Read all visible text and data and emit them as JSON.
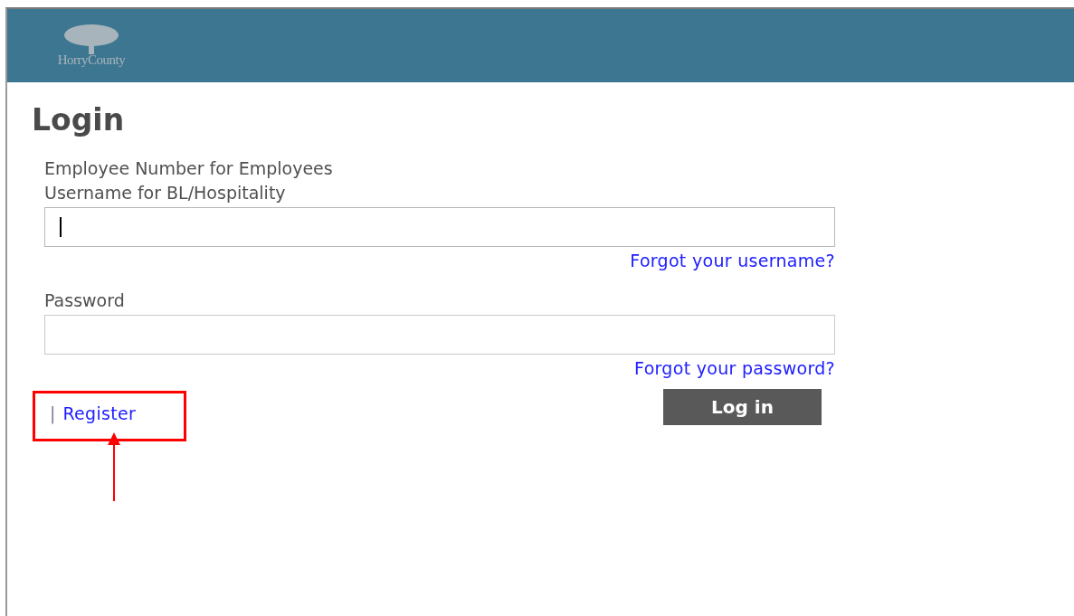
{
  "header": {
    "logo_text": "HorryCounty"
  },
  "title": "Login",
  "fields": [
    {
      "label_lines": [
        "Employee Number for Employees",
        "Username for BL/Hospitality"
      ],
      "focused": true,
      "link": "Forgot your username?"
    },
    {
      "label_lines": [
        "Password"
      ],
      "focused": false,
      "link": "Forgot your password?"
    }
  ],
  "separator": "|",
  "register_link": "Register",
  "login_button": "Log in",
  "annotation": {
    "highlight": true
  }
}
